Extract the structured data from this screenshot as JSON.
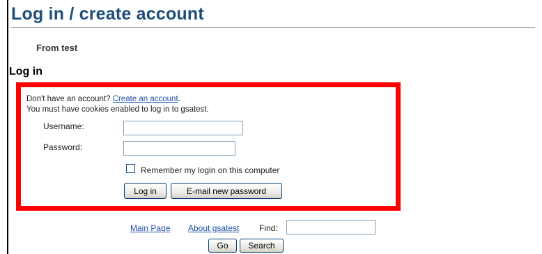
{
  "page": {
    "title": "Log in / create account",
    "subtitle": "From test"
  },
  "login": {
    "heading": "Log in",
    "no_account_text": "Don't have an account? ",
    "create_account_link": "Create an account",
    "no_account_suffix": ".",
    "cookies_notice": "You must have cookies enabled to log in to gsatest.",
    "username_label": "Username:",
    "username_value": "",
    "password_label": "Password:",
    "password_value": "",
    "remember_label": "Remember my login on this computer",
    "remember_checked": false,
    "login_button": "Log in",
    "email_password_button": "E-mail new password",
    "highlight_color": "#ff0000"
  },
  "footer": {
    "main_page_link": "Main Page",
    "about_link": "About gsatest",
    "find_label": "Find:",
    "find_value": "",
    "go_button": "Go",
    "search_button": "Search"
  },
  "colors": {
    "title": "#1f4e79",
    "link": "#1f4fa8"
  }
}
